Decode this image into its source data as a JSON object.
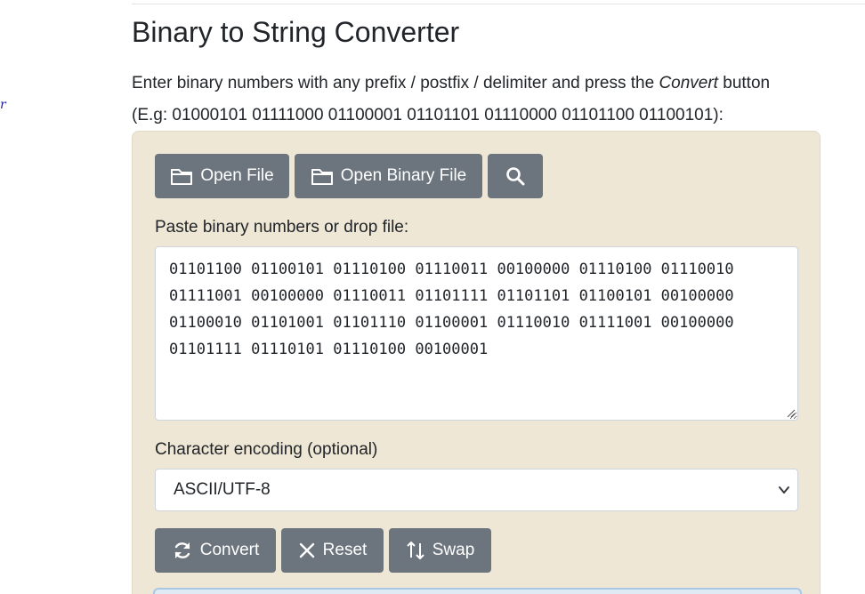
{
  "page": {
    "title": "Binary to String Converter",
    "side_mark": "r",
    "intro_before": "Enter binary numbers with any prefix / postfix / delimiter and press the ",
    "intro_em": "Convert",
    "intro_after": " button",
    "intro_example": "(E.g: 01000101 01111000 01100001 01101101 01110000 01101100 01100101):"
  },
  "toolbar": {
    "open_file_label": "Open File",
    "open_binary_file_label": "Open Binary File",
    "search_icon": "search-icon",
    "folder_icon": "folder-icon"
  },
  "input": {
    "label": "Paste binary numbers or drop file:",
    "value": "01101100 01100101 01110100 01110011 00100000 01110100 01110010 01111001 00100000 01110011 01101111 01101101 01100101 00100000 01100010 01101001 01101110 01100001 01110010 01111001 00100000 01101111 01110101 01110100 00100001"
  },
  "encoding": {
    "label": "Character encoding (optional)",
    "selected": "ASCII/UTF-8"
  },
  "actions": {
    "convert_label": "Convert",
    "reset_label": "Reset",
    "swap_label": "Swap"
  },
  "colors": {
    "button_gray": "#6c757d",
    "panel_bg": "#efe7d5",
    "output_border": "#a9c8e4"
  }
}
